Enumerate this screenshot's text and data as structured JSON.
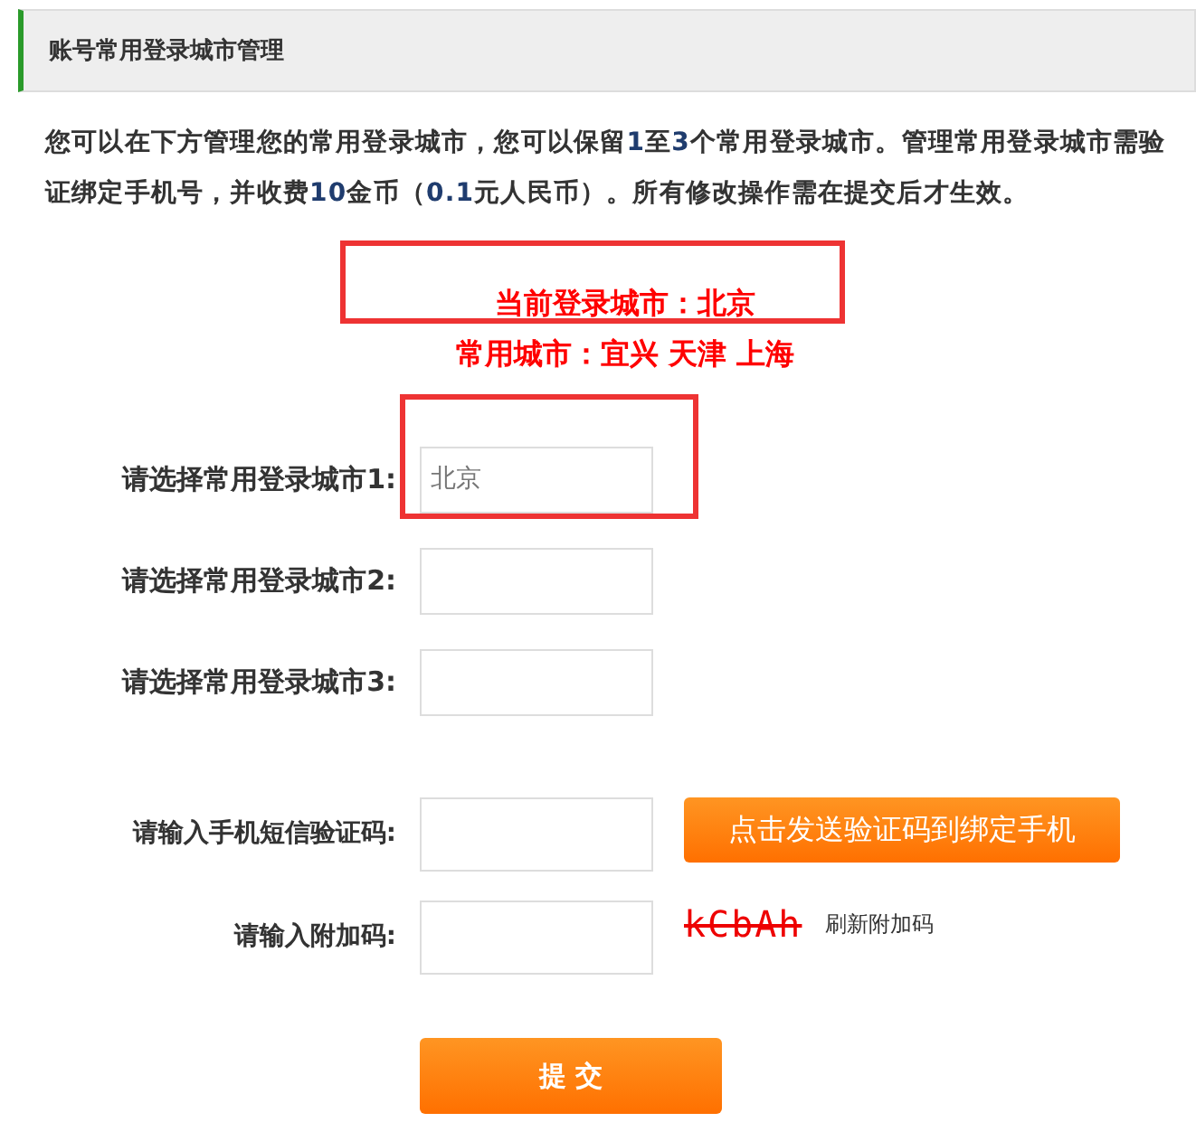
{
  "header": {
    "title": "账号常用登录城市管理"
  },
  "intro": "您可以在下方管理您的常用登录城市，您可以保留**1**至**3**个常用登录城市。管理常用登录城市需验证绑定手机号，并收费**10**金币（**0.1**元人民币）。所有修改操作需在提交后才生效。",
  "current_city": "当前登录城市：北京",
  "frequent_cities": "常用城市：宜兴 天津 上海",
  "city_fields": [
    {
      "label": "请选择常用登录城市1:",
      "value": "北京"
    },
    {
      "label": "请选择常用登录城市2:"
    },
    {
      "label": "请选择常用登录城市3:"
    }
  ],
  "sms": {
    "label": "请输入手机短信验证码:",
    "button": "点击发送验证码到绑定手机"
  },
  "captcha": {
    "label": "请输入附加码:",
    "code": "kCbAh",
    "refresh": "刷新附加码"
  },
  "submit": "提 交",
  "annotations": [
    {
      "kind": "box"
    },
    {
      "kind": "box"
    }
  ]
}
